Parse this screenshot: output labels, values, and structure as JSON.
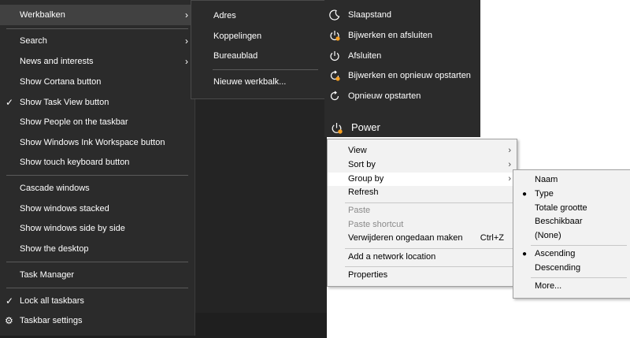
{
  "taskbar_menu": {
    "items": [
      {
        "label": "Werkbalken",
        "arrow": "›"
      },
      {
        "label": "Search",
        "arrow": "›"
      },
      {
        "label": "News and interests",
        "arrow": "›"
      },
      {
        "label": "Show Cortana button"
      },
      {
        "label": "Show Task View button",
        "check": "✓"
      },
      {
        "label": "Show People on the taskbar"
      },
      {
        "label": "Show Windows Ink Workspace button"
      },
      {
        "label": "Show touch keyboard button"
      },
      {
        "label": "Cascade windows"
      },
      {
        "label": "Show windows stacked"
      },
      {
        "label": "Show windows side by side"
      },
      {
        "label": "Show the desktop"
      },
      {
        "label": "Task Manager"
      },
      {
        "label": "Lock all taskbars",
        "check": "✓"
      },
      {
        "label": "Taskbar settings",
        "icon": "gear-icon",
        "glyph": "⚙"
      }
    ]
  },
  "toolbars_submenu": {
    "items": [
      {
        "label": "Adres"
      },
      {
        "label": "Koppelingen"
      },
      {
        "label": "Bureaublad"
      },
      {
        "label": "Nieuwe werkbalk..."
      }
    ]
  },
  "power_menu": {
    "items": [
      {
        "label": "Slaapstand",
        "icon": "moon-icon"
      },
      {
        "label": "Bijwerken en afsluiten",
        "icon": "power-update-icon"
      },
      {
        "label": "Afsluiten",
        "icon": "power-icon"
      },
      {
        "label": "Bijwerken en opnieuw opstarten",
        "icon": "restart-update-icon"
      },
      {
        "label": "Opnieuw opstarten",
        "icon": "restart-icon"
      }
    ],
    "label": "Power",
    "label_icon": "power-update-icon",
    "accent_color": "#f7a021"
  },
  "explorer_context_menu": {
    "items": [
      {
        "label": "View",
        "arrow": "›"
      },
      {
        "label": "Sort by",
        "arrow": "›"
      },
      {
        "label": "Group by",
        "arrow": "›"
      },
      {
        "label": "Refresh"
      },
      {
        "label": "Paste",
        "disabled": true
      },
      {
        "label": "Paste shortcut",
        "disabled": true
      },
      {
        "label": "Verwijderen ongedaan maken",
        "shortcut": "Ctrl+Z"
      },
      {
        "label": "Add a network location"
      },
      {
        "label": "Properties"
      }
    ]
  },
  "group_by_submenu": {
    "items": [
      {
        "label": "Naam"
      },
      {
        "label": "Type",
        "bullet": "●"
      },
      {
        "label": "Totale grootte"
      },
      {
        "label": "Beschikbaar"
      },
      {
        "label": "(None)"
      },
      {
        "label": "Ascending",
        "bullet": "●"
      },
      {
        "label": "Descending"
      },
      {
        "label": "More..."
      }
    ]
  }
}
